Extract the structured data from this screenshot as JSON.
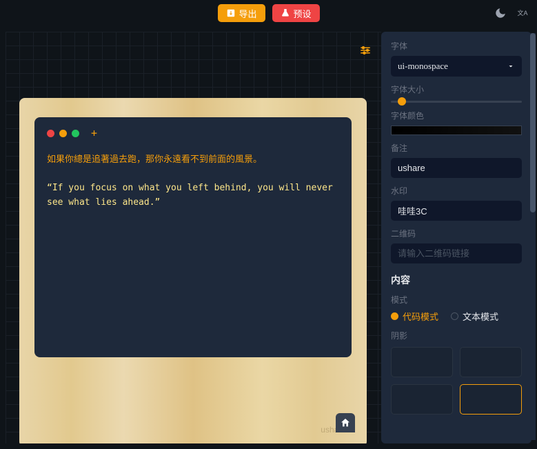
{
  "topbar": {
    "export_label": "导出",
    "preset_label": "预设"
  },
  "preview": {
    "line1": "如果你總是追著過去跑，那你永遠看不到前面的風景。",
    "line2": "“If you focus on what you left behind, you will never see what lies ahead.”",
    "watermark": "ushare"
  },
  "sidebar": {
    "font_label": "字体",
    "font_value": "ui-monospace",
    "fontsize_label": "字体大小",
    "fontcolor_label": "字体颜色",
    "note_label": "备注",
    "note_value": "ushare",
    "watermark_label": "水印",
    "watermark_value": "哇哇3C",
    "qrcode_label": "二维码",
    "qrcode_placeholder": "请输入二维码链接",
    "content_title": "内容",
    "mode_label": "模式",
    "mode_code": "代码模式",
    "mode_text": "文本模式",
    "shadow_label": "阴影"
  }
}
